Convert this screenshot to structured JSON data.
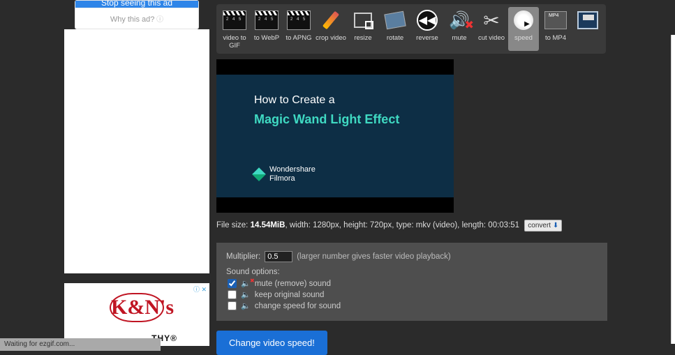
{
  "ads": {
    "stop_label": "Stop seeing this ad",
    "why_label": "Why this ad?",
    "kn_logo": "K&N's",
    "slogan_fragment": ".THY®",
    "close_marker": "ⓘ ✕"
  },
  "status_bar": "Waiting for ezgif.com...",
  "toolbar": [
    {
      "label": "video to GIF",
      "icon": "clapper"
    },
    {
      "label": "to WebP",
      "icon": "clapper"
    },
    {
      "label": "to APNG",
      "icon": "clapper"
    },
    {
      "label": "crop video",
      "icon": "crop"
    },
    {
      "label": "resize",
      "icon": "resize"
    },
    {
      "label": "rotate",
      "icon": "rotate"
    },
    {
      "label": "reverse",
      "icon": "reverse"
    },
    {
      "label": "mute",
      "icon": "mute"
    },
    {
      "label": "cut video",
      "icon": "scissors"
    },
    {
      "label": "speed",
      "icon": "speed",
      "active": true
    },
    {
      "label": "to MP4",
      "icon": "mp4"
    },
    {
      "label": "",
      "icon": "save"
    }
  ],
  "video": {
    "line1": "How to Create a",
    "line2": "Magic Wand Light Effect",
    "brand": "Wondershare",
    "brand2": "Filmora"
  },
  "fileinfo": {
    "prefix": "File size: ",
    "size": "14.54MiB",
    "rest": ", width: 1280px, height: 720px, type: mkv (video), length: 00:03:51",
    "convert_label": "convert"
  },
  "form": {
    "multiplier_label": "Multiplier:",
    "multiplier_value": "0.5",
    "multiplier_hint": "(larger number gives faster video playback)",
    "sound_header": "Sound options:",
    "opt_mute": "mute (remove) sound",
    "opt_keep": "keep original sound",
    "opt_change": "change speed for sound",
    "submit_label": "Change video speed!"
  }
}
